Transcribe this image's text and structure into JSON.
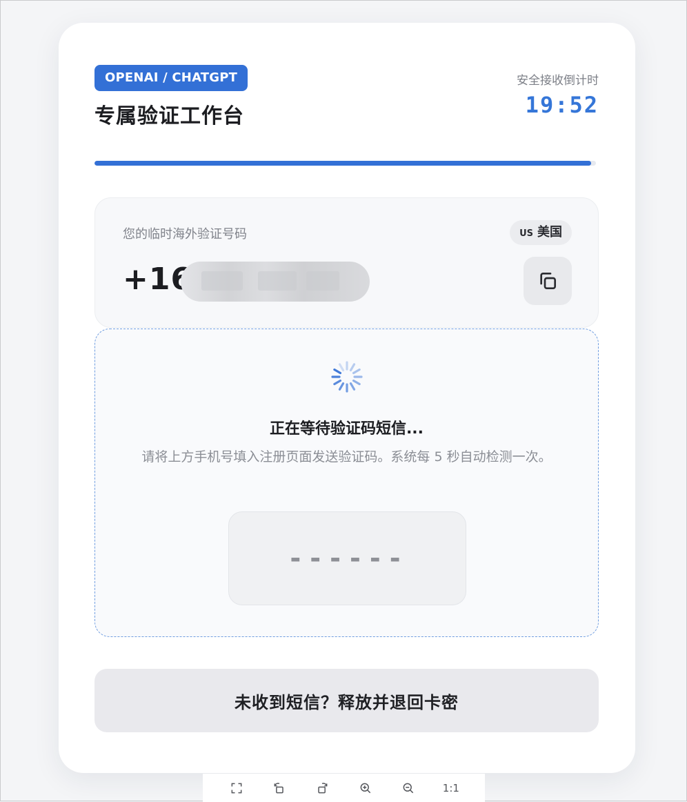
{
  "header": {
    "badge": "OPENAI / CHATGPT",
    "title": "专属验证工作台",
    "timer_label": "安全接收倒计时",
    "timer_value": "19:52"
  },
  "progress": {
    "fraction": 0.99,
    "color": "#3370d6"
  },
  "phone": {
    "label": "您的临时海外验证号码",
    "country_code": "US",
    "country_name": "美国",
    "number_visible_prefix": "+16",
    "number_obscured": true,
    "copy_icon": "copy-icon"
  },
  "waiting": {
    "title": "正在等待验证码短信...",
    "description": "请将上方手机号填入注册页面发送验证码。系统每 5 秒自动检测一次。",
    "code_placeholder": "------"
  },
  "actions": {
    "release_label": "未收到短信？释放并退回卡密"
  },
  "viewer_toolbar": {
    "fit_icon": "fullscreen-icon",
    "rotate_left_icon": "rotate-left-icon",
    "rotate_right_icon": "rotate-right-icon",
    "zoom_in_icon": "zoom-in-icon",
    "zoom_out_icon": "zoom-out-icon",
    "actual_size_label": "1:1"
  },
  "colors": {
    "accent": "#3370d6",
    "timer": "#3576d8",
    "dashed_border": "#6f9de0"
  }
}
